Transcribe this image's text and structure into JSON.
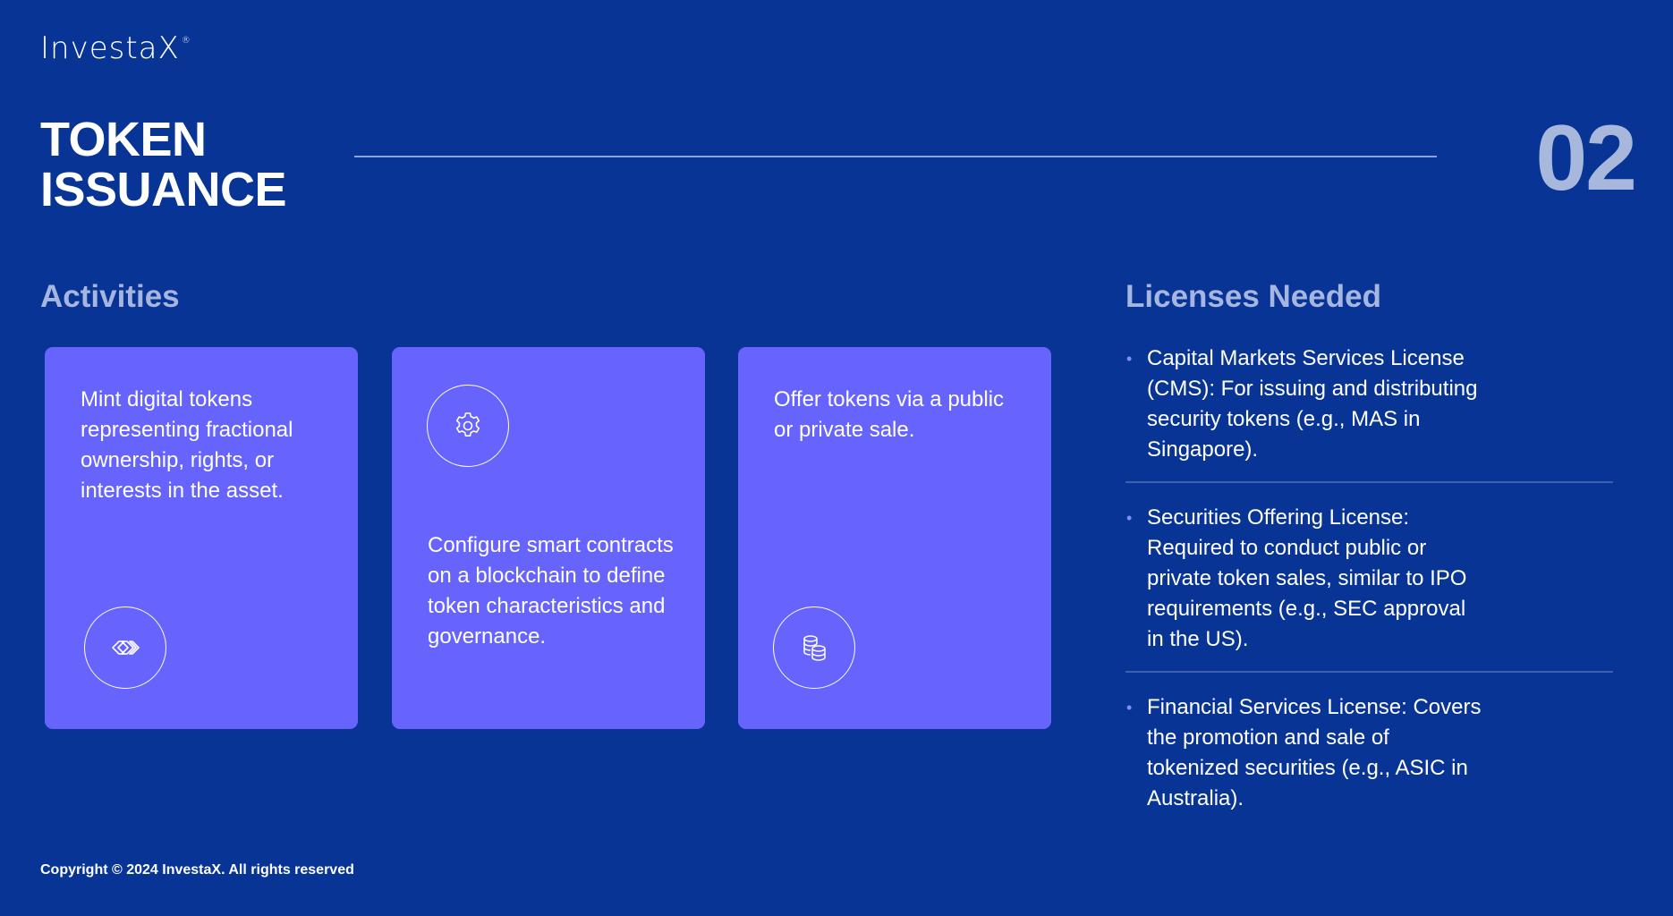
{
  "brand": {
    "logo_text": "InvestaX",
    "logo_mark": "®"
  },
  "header": {
    "title_line1": "TOKEN",
    "title_line2": "ISSUANCE",
    "section_number": "02"
  },
  "activities": {
    "heading": "Activities",
    "cards": [
      {
        "text": "Mint digital tokens representing fractional ownership, rights, or interests in the asset.",
        "icon": "chevrons-icon"
      },
      {
        "text": "Configure smart contracts on a blockchain to define token characteristics and governance.",
        "icon": "gear-icon"
      },
      {
        "text": "Offer tokens via a public or private sale.",
        "icon": "coins-icon"
      }
    ]
  },
  "licenses": {
    "heading": "Licenses Needed",
    "bullet": "•",
    "items": [
      {
        "text": "Capital Markets Services License (CMS): For issuing and distributing security tokens (e.g., MAS in Singapore)."
      },
      {
        "text": "Securities Offering License: Required to conduct public or private token sales, similar to IPO requirements (e.g., SEC approval in the US)."
      },
      {
        "text": "Financial Services License: Covers the promotion and sale of tokenized securities (e.g., ASIC in Australia)."
      }
    ]
  },
  "footer": {
    "copyright": "Copyright © 2024 InvestaX. All rights reserved"
  },
  "colors": {
    "background": "#083595",
    "card": "#6764fd",
    "heading_muted": "#a6b6e0",
    "section_number": "#a8b8dd"
  }
}
